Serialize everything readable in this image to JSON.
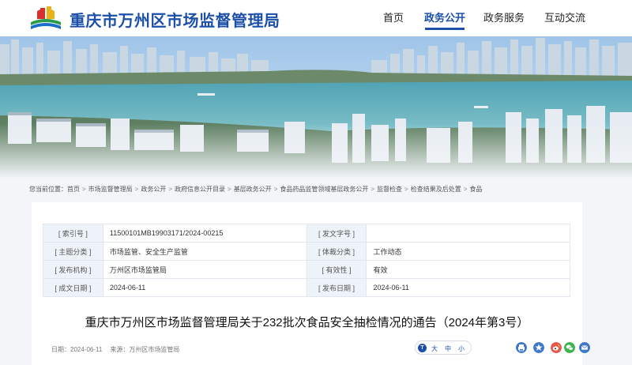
{
  "header": {
    "site_title": "重庆市万州区市场监督管理局",
    "nav": [
      {
        "label": "首页"
      },
      {
        "label": "政务公开"
      },
      {
        "label": "政务服务"
      },
      {
        "label": "互动交流"
      }
    ],
    "active_nav": "政务公开",
    "brand_color": "#1c4fa8"
  },
  "breadcrumb": {
    "prefix": "您当前位置：",
    "items": [
      "首页",
      "市场监督管理局",
      "政务公开",
      "政府信息公开目录",
      "基层政务公开",
      "食品药品监管领域基层政务公开",
      "监督检查",
      "检查结果及后处置",
      "食品"
    ]
  },
  "meta": {
    "rows": [
      {
        "label1": "[ 索引号 ]",
        "value1": "11500101MB19903171/2024-00215",
        "label2": "[ 发文字号 ]",
        "value2": ""
      },
      {
        "label1": "[ 主题分类 ]",
        "value1": "市场监管、安全生产监管",
        "label2": "[ 体裁分类 ]",
        "value2": "工作动态"
      },
      {
        "label1": "[ 发布机构 ]",
        "value1": "万州区市场监管局",
        "label2": "[ 有效性 ]",
        "value2": "有效"
      },
      {
        "label1": "[ 成文日期 ]",
        "value1": "2024-06-11",
        "label2": "[ 发布日期 ]",
        "value2": "2024-06-11"
      }
    ]
  },
  "article": {
    "title": "重庆市万州区市场监督管理局关于232批次食品安全抽检情况的通告（2024年第3号）",
    "date": "日期：2024-06-11",
    "source": "来源：万州区市场监管局"
  },
  "font_size": {
    "icon_glyph": "T",
    "options": [
      "大",
      "中",
      "小"
    ]
  },
  "share_icons": [
    "print-icon",
    "qzone-icon",
    "weibo-icon",
    "wechat-icon",
    "email-icon"
  ]
}
